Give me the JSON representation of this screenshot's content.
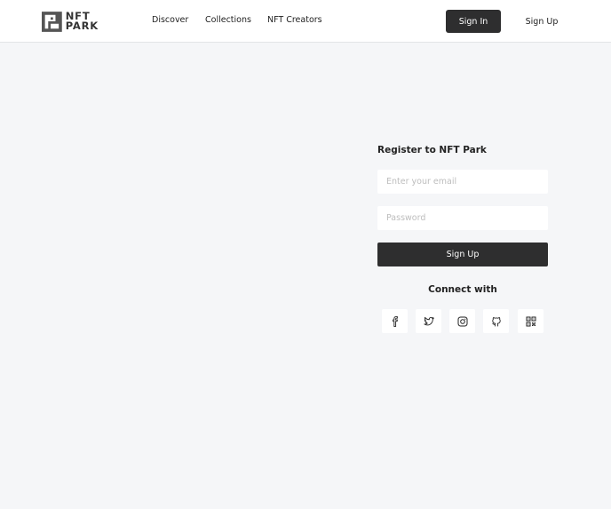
{
  "header": {
    "logo": {
      "line1": "NFT",
      "line2": "PARK"
    },
    "nav": [
      {
        "label": "Discover"
      },
      {
        "label": "Collections"
      },
      {
        "label": "NFT Creators"
      }
    ],
    "sign_in_label": "Sign In",
    "sign_up_label": "Sign Up"
  },
  "register": {
    "title": "Register to NFT Park",
    "email_placeholder": "Enter your email",
    "password_placeholder": "Password",
    "submit_label": "Sign Up",
    "connect_title": "Connect with",
    "socials": [
      {
        "icon": "facebook-icon"
      },
      {
        "icon": "twitter-icon"
      },
      {
        "icon": "instagram-icon"
      },
      {
        "icon": "github-icon"
      },
      {
        "icon": "qr-code-icon"
      }
    ]
  },
  "colors": {
    "background": "#f5f6f8",
    "header": "#ffffff",
    "primary_button": "#2e2e2f",
    "text": "#222222",
    "placeholder": "#bdbdbd"
  }
}
